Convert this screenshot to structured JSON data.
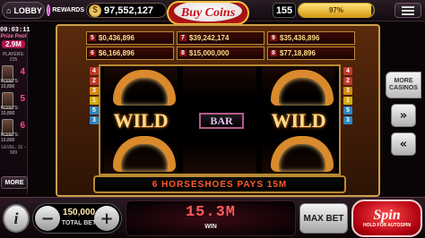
{
  "header": {
    "home_label": "LOBBY",
    "rewards_label": "REWARDS",
    "balance": "97,552,127",
    "buy_coins": "Buy Coins",
    "level": "155",
    "xp_percent": "97%",
    "xp_fraction": 0.97
  },
  "leaderboard": {
    "timer": "00:03:11",
    "prize_label": "Prize Pool",
    "prize_value": "2.9M",
    "players_label": "PLAYERS: 215",
    "players": [
      {
        "rank": "4",
        "points": "10,800"
      },
      {
        "rank": "5",
        "points": "10,800"
      },
      {
        "rank": "6",
        "points": "10,800"
      }
    ],
    "level_range": "LEVEL: 31 - 999",
    "more_label": "MORE"
  },
  "paytable": {
    "rows": [
      [
        {
          "n": "5",
          "value": "$0,436,896"
        },
        {
          "n": "7",
          "value": "$39,242,174"
        },
        {
          "n": "9",
          "value": "$35,436,896"
        }
      ],
      [
        {
          "n": "6",
          "value": "$6,166,896"
        },
        {
          "n": "8",
          "value": "$15,000,000"
        },
        {
          "n": "8",
          "value": "$77,18,896"
        }
      ]
    ]
  },
  "reels": {
    "left_symbol": "WILD",
    "center_symbol": "BAR",
    "right_symbol": "WILD"
  },
  "paylines": {
    "left": [
      "4",
      "2",
      "3",
      "1",
      "5",
      "3"
    ],
    "right": [
      "4",
      "2",
      "3",
      "1",
      "5",
      "3"
    ]
  },
  "win_banner": "6 HORSESHOES PAYS 15M",
  "side": {
    "more_casinos": "MORE CASINOS"
  },
  "bottom": {
    "info_label": "i",
    "minus_label": "−",
    "plus_label": "+",
    "total_bet": "150,000",
    "total_bet_label": "TOTAL BET",
    "win_amount": "15.3M",
    "win_label": "WIN",
    "max_bet": "MAX BET",
    "spin_label": "Spin",
    "spin_sub": "HOLD FOR AUTOSPIN"
  },
  "colors": {
    "accent_red": "#c8101c",
    "gold": "#caa04a",
    "win_text": "#ff5a2a"
  }
}
